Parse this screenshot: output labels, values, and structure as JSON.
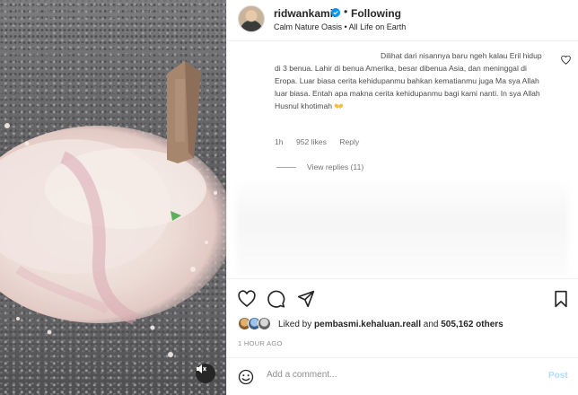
{
  "header": {
    "username": "ridwankamil",
    "follow_separator": "•",
    "follow_status": "Following",
    "subtitle": "Calm Nature Oasis • All Life on Earth"
  },
  "comment": {
    "text": "Dilihat dari nisannya baru ngeh kalau Eril hidup di 3 benua. Lahir di benua Amerika, besar dibenua Asia, dan meninggal di Eropa. Luar biasa cerita kehidupanmu bahkan kematianmu juga Ma sya Allah luar biasa. Entah apa makna cerita kehidupanmu bagi kami nanti. In sya Allah Husnul khotimah 👐",
    "time": "1h",
    "likes": "952 likes",
    "reply_label": "Reply",
    "view_replies": "View replies (11)"
  },
  "likes_bar": {
    "prefix": "Liked by",
    "liker": "pembasmi.kehaluan.reall",
    "conjunction": "and",
    "others": "505,162 others"
  },
  "timestamp": "1 HOUR AGO",
  "add_comment": {
    "placeholder": "Add a comment...",
    "post_label": "Post"
  },
  "icons": {
    "verified": "verified-badge-icon",
    "like": "heart-icon",
    "comment": "comment-bubble-icon",
    "share": "paper-plane-icon",
    "save": "bookmark-icon",
    "emoji": "emoji-smile-icon",
    "mute": "speaker-muted-icon"
  },
  "colors": {
    "verified_blue": "#0095f6",
    "post_disabled": "#b3dbff",
    "muted_text": "#737373"
  }
}
